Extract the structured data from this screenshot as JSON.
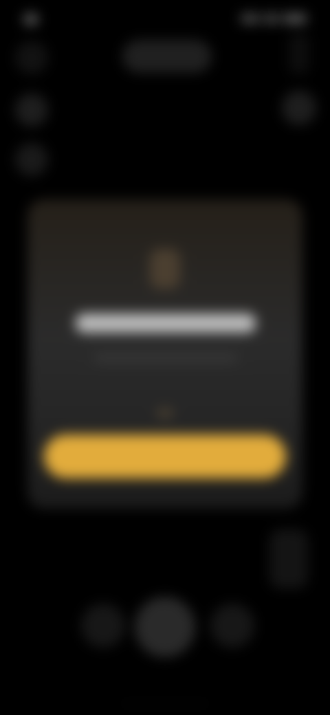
{
  "status_bar": {
    "time": "",
    "icons": [
      "signal-icon",
      "wifi-icon",
      "battery-icon"
    ]
  },
  "top_bar": {
    "mode_pill": ""
  },
  "left_controls": [
    "flash-icon",
    "timer-icon",
    "settings-icon"
  ],
  "right_controls": [
    "more-icon"
  ],
  "permission_card": {
    "icon": "camera-icon",
    "title": "",
    "subtitle": "",
    "button_label": "",
    "accent_color": "#e2ac3c"
  },
  "bottom_controls": [
    "gallery-icon",
    "shutter-button",
    "flip-camera-icon"
  ],
  "colors": {
    "background": "#000000",
    "card": "#2b2b2b",
    "accent": "#e2ac3c"
  }
}
